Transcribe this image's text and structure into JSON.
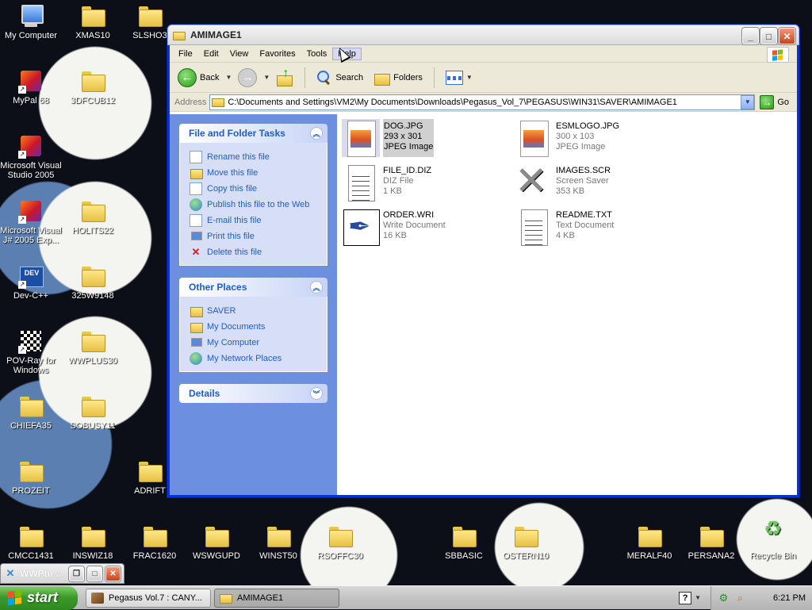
{
  "desktop": {
    "icons": [
      {
        "label": "My Computer",
        "icon": "computer-icon"
      },
      {
        "label": "XMAS10",
        "icon": "folder-icon"
      },
      {
        "label": "SLSHO3",
        "icon": "folder-icon"
      },
      {
        "label": "MyPal 68",
        "icon": "app-shortcut-icon"
      },
      {
        "label": "3DFCUB12",
        "icon": "folder-icon"
      },
      {
        "label": "Microsoft Visual Studio 2005",
        "icon": "visual-studio-icon"
      },
      {
        "label": "Microsoft Visual J# 2005 Exp...",
        "icon": "visual-jsharp-icon"
      },
      {
        "label": "HOLITS22",
        "icon": "folder-icon"
      },
      {
        "label": "Dev-C++",
        "icon": "devcpp-icon"
      },
      {
        "label": "325W9148",
        "icon": "folder-icon"
      },
      {
        "label": "POV-Ray for Windows",
        "icon": "povray-icon"
      },
      {
        "label": "WWPLUS30",
        "icon": "folder-icon"
      },
      {
        "label": "CHIEFA35",
        "icon": "folder-icon"
      },
      {
        "label": "SOBUSY11",
        "icon": "folder-icon"
      },
      {
        "label": "PROZEIT",
        "icon": "folder-icon"
      },
      {
        "label": "ADRIFT",
        "icon": "folder-icon"
      },
      {
        "label": "CMCC1431",
        "icon": "folder-icon"
      },
      {
        "label": "INSWIZ18",
        "icon": "folder-icon"
      },
      {
        "label": "FRAC1620",
        "icon": "folder-icon"
      },
      {
        "label": "WSWGUPD",
        "icon": "folder-icon"
      },
      {
        "label": "WINST50",
        "icon": "folder-icon"
      },
      {
        "label": "RSOFFC30",
        "icon": "folder-icon"
      },
      {
        "label": "SBBASIC",
        "icon": "folder-icon"
      },
      {
        "label": "OSTERN10",
        "icon": "folder-icon"
      },
      {
        "label": "MERALF40",
        "icon": "folder-icon"
      },
      {
        "label": "PERSANA2",
        "icon": "folder-icon"
      },
      {
        "label": "Recycle Bin",
        "icon": "recycle-bin-icon"
      }
    ]
  },
  "window": {
    "title": "AMIMAGE1",
    "menu": [
      "File",
      "Edit",
      "View",
      "Favorites",
      "Tools",
      "Help"
    ],
    "toolbar": {
      "back": "Back",
      "search": "Search",
      "folders": "Folders"
    },
    "address": {
      "label": "Address",
      "value": "C:\\Documents and Settings\\VM2\\My Documents\\Downloads\\Pegasus_Vol_7\\PEGASUS\\WIN31\\SAVER\\AMIMAGE1",
      "go": "Go"
    },
    "tasks_panel": {
      "title": "File and Folder Tasks",
      "items": [
        {
          "label": "Rename this file",
          "icon": "rename-icon"
        },
        {
          "label": "Move this file",
          "icon": "move-icon"
        },
        {
          "label": "Copy this file",
          "icon": "copy-icon"
        },
        {
          "label": "Publish this file to the Web",
          "icon": "publish-icon"
        },
        {
          "label": "E-mail this file",
          "icon": "email-icon"
        },
        {
          "label": "Print this file",
          "icon": "print-icon"
        },
        {
          "label": "Delete this file",
          "icon": "delete-icon"
        }
      ]
    },
    "places_panel": {
      "title": "Other Places",
      "items": [
        {
          "label": "SAVER",
          "icon": "folder-icon"
        },
        {
          "label": "My Documents",
          "icon": "folder-icon"
        },
        {
          "label": "My Computer",
          "icon": "computer-icon"
        },
        {
          "label": "My Network Places",
          "icon": "network-icon"
        }
      ]
    },
    "details_panel": {
      "title": "Details"
    },
    "files": [
      {
        "name": "DOG.JPG",
        "line2": "293 x 301",
        "line3": "JPEG Image",
        "icon": "jpeg-icon",
        "selected": true
      },
      {
        "name": "ESMLOGO.JPG",
        "line2": "300 x 103",
        "line3": "JPEG Image",
        "icon": "jpeg-icon",
        "selected": false
      },
      {
        "name": "FILE_ID.DIZ",
        "line2": "DIZ File",
        "line3": "1 KB",
        "icon": "text-file-icon",
        "selected": false
      },
      {
        "name": "IMAGES.SCR",
        "line2": "Screen Saver",
        "line3": "353 KB",
        "icon": "screensaver-icon",
        "selected": false
      },
      {
        "name": "ORDER.WRI",
        "line2": "Write Document",
        "line3": "16 KB",
        "icon": "write-document-icon",
        "selected": false
      },
      {
        "name": "README.TXT",
        "line2": "Text Document",
        "line3": "4 KB",
        "icon": "text-file-icon",
        "selected": false
      }
    ]
  },
  "minimized_window": {
    "title": "WWPtu..."
  },
  "taskbar": {
    "start": "start",
    "tasks": [
      {
        "label": "Pegasus Vol.7 : CANY...",
        "active": false
      },
      {
        "label": "AMIMAGE1",
        "active": true
      }
    ],
    "clock": "6:21 PM"
  }
}
